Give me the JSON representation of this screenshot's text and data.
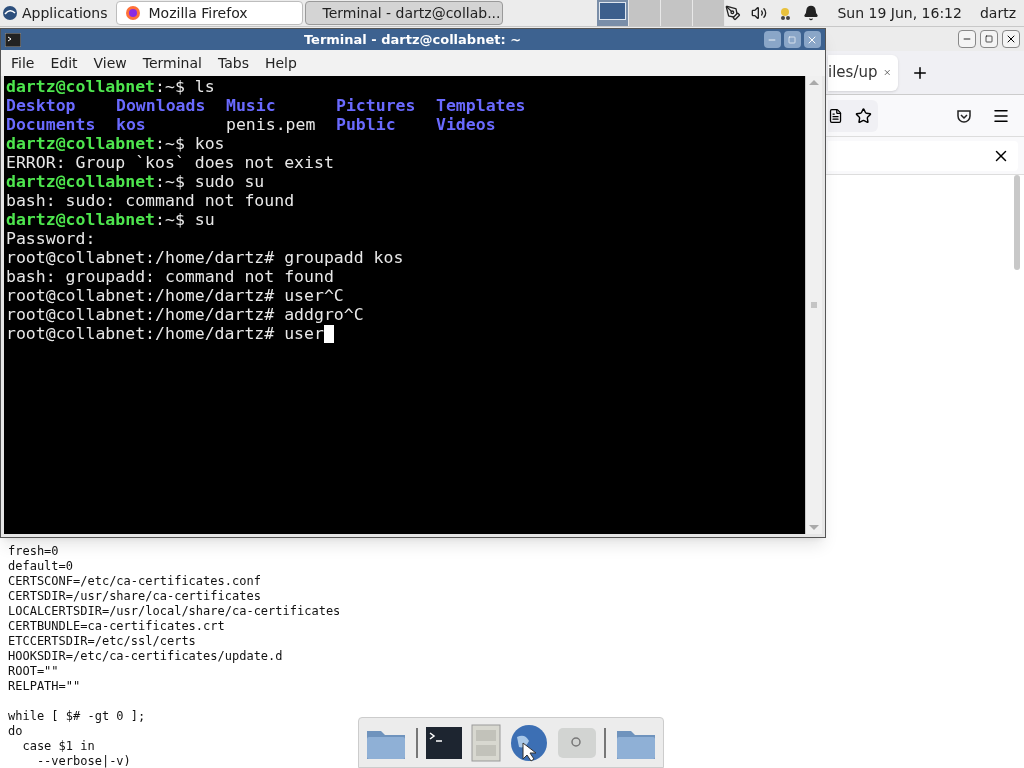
{
  "panel": {
    "apps_menu": "Applications",
    "tasks": [
      {
        "title": "Mozilla Firefox",
        "kind": "browser",
        "selected": false
      },
      {
        "title": "Terminal - dartz@collab...",
        "kind": "terminal",
        "selected": true
      }
    ],
    "workspaces": [
      {
        "selected": true
      },
      {
        "selected": false
      },
      {
        "selected": false
      },
      {
        "selected": false
      }
    ],
    "clock": "Sun 19 Jun, 16:12",
    "user": "dartz"
  },
  "browser": {
    "tab_title": "iles/up",
    "content_blocks": [
      [
        "fresh=0",
        "default=0",
        "CERTSCONF=/etc/ca-certificates.conf",
        "CERTSDIR=/usr/share/ca-certificates",
        "LOCALCERTSDIR=/usr/local/share/ca-certificates",
        "CERTBUNDLE=ca-certificates.crt",
        "ETCCERTSDIR=/etc/ssl/certs",
        "HOOKSDIR=/etc/ca-certificates/update.d",
        "ROOT=\"\"",
        "RELPATH=\"\""
      ],
      [
        "while [ $# -gt 0 ];",
        "do",
        "  case $1 in",
        "    --verbose|-v)"
      ]
    ]
  },
  "terminal": {
    "title": "Terminal - dartz@collabnet: ~",
    "menu": [
      "File",
      "Edit",
      "View",
      "Terminal",
      "Tabs",
      "Help"
    ],
    "cursor_visible": true,
    "lines": [
      {
        "kind": "text",
        "segments": [
          {
            "kind": "user",
            "text": "dartz@collabnet"
          },
          {
            "kind": "plain",
            "text": ":~$ ls"
          }
        ]
      },
      {
        "kind": "columns",
        "segments": [
          {
            "kind": "dir",
            "text": "Desktop"
          },
          {
            "kind": "dir",
            "text": "Downloads"
          },
          {
            "kind": "dir",
            "text": "Music"
          },
          {
            "kind": "dir",
            "text": "Pictures"
          },
          {
            "kind": "dir",
            "text": "Templates"
          }
        ]
      },
      {
        "kind": "columns",
        "segments": [
          {
            "kind": "dir",
            "text": "Documents"
          },
          {
            "kind": "dir",
            "text": "kos"
          },
          {
            "kind": "plain",
            "text": "penis.pem"
          },
          {
            "kind": "dir",
            "text": "Public"
          },
          {
            "kind": "dir",
            "text": "Videos"
          }
        ]
      },
      {
        "kind": "text",
        "segments": [
          {
            "kind": "user",
            "text": "dartz@collabnet"
          },
          {
            "kind": "plain",
            "text": ":~$ kos"
          }
        ]
      },
      {
        "kind": "text",
        "segments": [
          {
            "kind": "plain",
            "text": "ERROR: Group `kos` does not exist"
          }
        ]
      },
      {
        "kind": "text",
        "segments": [
          {
            "kind": "user",
            "text": "dartz@collabnet"
          },
          {
            "kind": "plain",
            "text": ":~$ sudo su"
          }
        ]
      },
      {
        "kind": "text",
        "segments": [
          {
            "kind": "plain",
            "text": "bash: sudo: command not found"
          }
        ]
      },
      {
        "kind": "text",
        "segments": [
          {
            "kind": "user",
            "text": "dartz@collabnet"
          },
          {
            "kind": "plain",
            "text": ":~$ su"
          }
        ]
      },
      {
        "kind": "text",
        "segments": [
          {
            "kind": "plain",
            "text": "Password:"
          }
        ]
      },
      {
        "kind": "text",
        "segments": [
          {
            "kind": "plain",
            "text": "root@collabnet:/home/dartz# groupadd kos"
          }
        ]
      },
      {
        "kind": "text",
        "segments": [
          {
            "kind": "plain",
            "text": "bash: groupadd: command not found"
          }
        ]
      },
      {
        "kind": "text",
        "segments": [
          {
            "kind": "plain",
            "text": "root@collabnet:/home/dartz# user^C"
          }
        ]
      },
      {
        "kind": "text",
        "segments": [
          {
            "kind": "plain",
            "text": "root@collabnet:/home/dartz# addgro^C"
          }
        ]
      },
      {
        "kind": "text",
        "segments": [
          {
            "kind": "plain",
            "text": "root@collabnet:/home/dartz# user"
          }
        ]
      }
    ]
  }
}
